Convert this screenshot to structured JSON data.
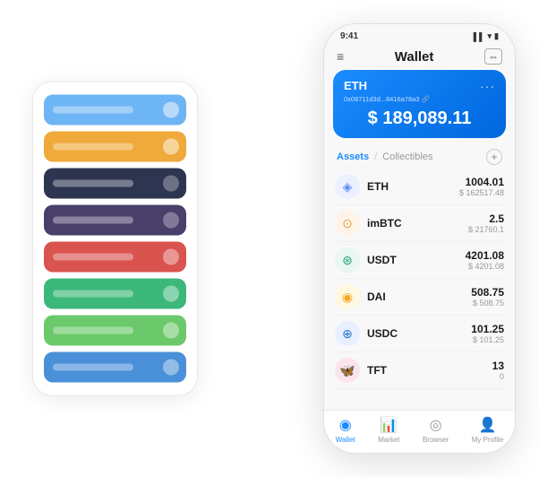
{
  "back_card": {
    "rows": [
      {
        "color": "#6eb5f5",
        "icon_color": "rgba(255,255,255,0.5)"
      },
      {
        "color": "#f0a93b",
        "icon_color": "rgba(255,255,255,0.5)"
      },
      {
        "color": "#2d3550",
        "icon_color": "rgba(255,255,255,0.3)"
      },
      {
        "color": "#4a3f6b",
        "icon_color": "rgba(255,255,255,0.3)"
      },
      {
        "color": "#d9534f",
        "icon_color": "rgba(255,255,255,0.4)"
      },
      {
        "color": "#3cb87a",
        "icon_color": "rgba(255,255,255,0.4)"
      },
      {
        "color": "#6bc96b",
        "icon_color": "rgba(255,255,255,0.4)"
      },
      {
        "color": "#4a90d9",
        "icon_color": "rgba(255,255,255,0.4)"
      }
    ]
  },
  "phone": {
    "status_bar": {
      "time": "9:41",
      "icons": "▌▌ ⟩ 🔋"
    },
    "header": {
      "title": "Wallet",
      "menu_label": "☰",
      "expand_label": "⇔"
    },
    "balance_card": {
      "currency": "ETH",
      "address": "0x08711d3d...8416a78a3 🔗",
      "amount": "$ 189,089.11"
    },
    "assets_section": {
      "tab_active": "Assets",
      "tab_divider": "/",
      "tab_inactive": "Collectibles",
      "add_label": "+"
    },
    "assets": [
      {
        "name": "ETH",
        "amount": "1004.01",
        "usd": "$ 162517.48",
        "icon": "◈",
        "icon_bg": "#ecf0ff",
        "icon_color": "#5c8cf5"
      },
      {
        "name": "imBTC",
        "amount": "2.5",
        "usd": "$ 21760.1",
        "icon": "⊙",
        "icon_bg": "#fff3e8",
        "icon_color": "#e8a045"
      },
      {
        "name": "USDT",
        "amount": "4201.08",
        "usd": "$ 4201.08",
        "icon": "⊛",
        "icon_bg": "#e8f7f0",
        "icon_color": "#26a17b"
      },
      {
        "name": "DAI",
        "amount": "508.75",
        "usd": "$ 508.75",
        "icon": "◉",
        "icon_bg": "#fff8e0",
        "icon_color": "#f5a623"
      },
      {
        "name": "USDC",
        "amount": "101.25",
        "usd": "$ 101.25",
        "icon": "⊕",
        "icon_bg": "#e8f0ff",
        "icon_color": "#2775ca"
      },
      {
        "name": "TFT",
        "amount": "13",
        "usd": "0",
        "icon": "🦋",
        "icon_bg": "#fce4ec",
        "icon_color": "#e91e63"
      }
    ],
    "bottom_nav": [
      {
        "label": "Wallet",
        "active": true,
        "icon": "◉"
      },
      {
        "label": "Market",
        "active": false,
        "icon": "📊"
      },
      {
        "label": "Browser",
        "active": false,
        "icon": "◎"
      },
      {
        "label": "My Profile",
        "active": false,
        "icon": "👤"
      }
    ]
  }
}
